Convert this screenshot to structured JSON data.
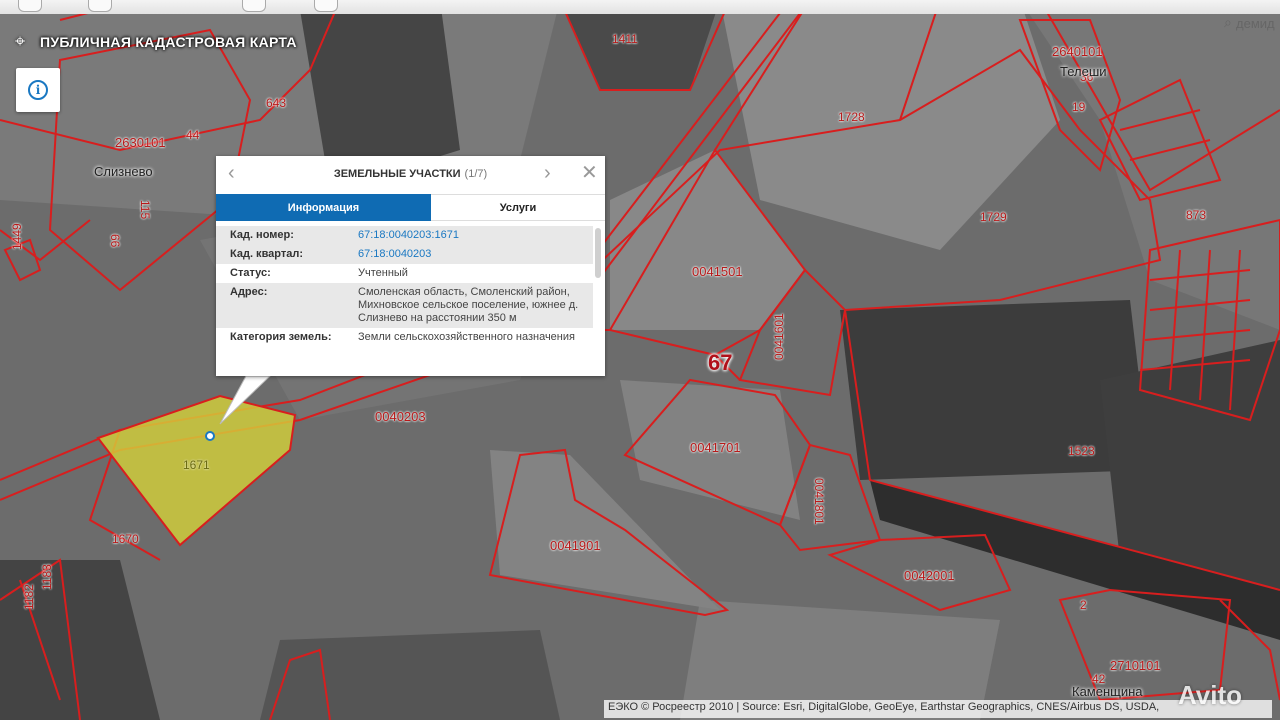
{
  "top": {
    "search_text": "демид"
  },
  "map": {
    "title": "ПУБЛИЧНАЯ КАДАСТРОВАЯ КАРТА",
    "region_number": "67",
    "selected_parcel_label": "1671",
    "places": [
      {
        "name": "Слизнево"
      },
      {
        "name": "Телеши"
      },
      {
        "name": "Каменщина"
      }
    ],
    "labels": {
      "q0041501": "0041501",
      "q0041601": "0041601",
      "q0041701": "0041701",
      "q0041801": "0041801",
      "q0041901": "0041901",
      "q0042001": "0042001",
      "q0040203": "0040203",
      "q2630101": "2630101",
      "q2640101": "2640101",
      "q2710101": "2710101",
      "p1411": "1411",
      "p1728": "1728",
      "p1729": "1729",
      "p873": "873",
      "p643": "643",
      "p1449": "1449",
      "p1670": "1670",
      "p1523": "1523",
      "p1182": "1182",
      "p1183": "1183",
      "p36": "36",
      "p19": "19",
      "p115": "115",
      "p44": "44",
      "p66": "66",
      "p2": "2",
      "p42": "42"
    }
  },
  "popup": {
    "title": "ЗЕМЕЛЬНЫЕ УЧАСТКИ",
    "counter": "(1/7)",
    "tab_info": "Информация",
    "tab_services": "Услуги",
    "rows": [
      {
        "key": "Кад. номер:",
        "value": "67:18:0040203:1671"
      },
      {
        "key": "Кад. квартал:",
        "value": "67:18:0040203"
      },
      {
        "key": "Статус:",
        "value": "Учтенный"
      },
      {
        "key": "Адрес:",
        "value": "Смоленская область, Смоленский район, Михновское сельское поселение, южнее д. Слизнево на расстоянии 350 м"
      },
      {
        "key": "Категория земель:",
        "value": "Земли сельскохозяйственного назначения"
      }
    ]
  },
  "attribution": "ЕЭКО © Росреестр 2010 | Source: Esri, DigitalGlobe, GeoEye, Earthstar Geographics, CNES/Airbus DS, USDA,",
  "watermark": "Avito",
  "colors": {
    "boundary": "#d81e1e",
    "selected_fill": "#d6d23a",
    "accent": "#0f6bb3"
  }
}
